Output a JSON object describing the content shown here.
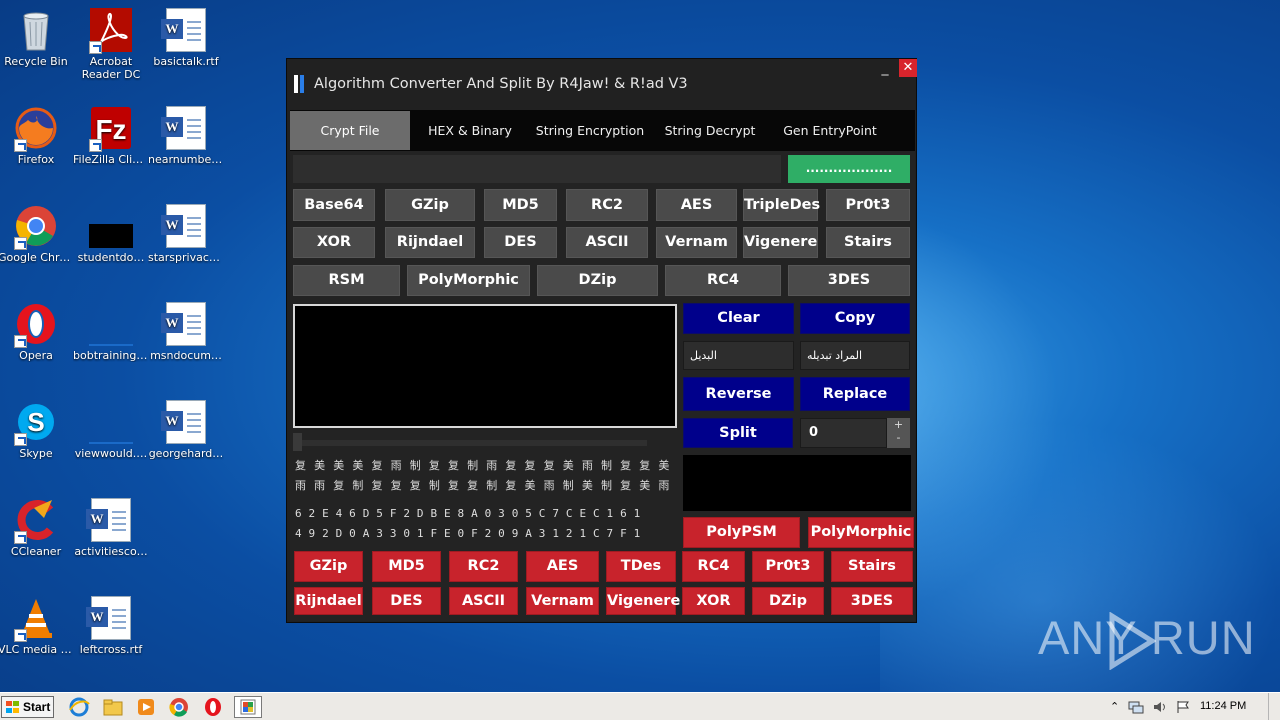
{
  "desktop": {
    "icons": [
      {
        "label": "Recycle Bin",
        "icon": "recycle-bin-icon"
      },
      {
        "label": "Acrobat Reader DC",
        "icon": "acrobat-icon"
      },
      {
        "label": "basictalk.rtf",
        "icon": "word-doc-icon"
      },
      {
        "label": "Firefox",
        "icon": "firefox-icon"
      },
      {
        "label": "FileZilla Client",
        "icon": "filezilla-icon"
      },
      {
        "label": "nearnumber…",
        "icon": "word-doc-icon"
      },
      {
        "label": "Google Chrome",
        "icon": "chrome-icon"
      },
      {
        "label": "studentdo…",
        "icon": "black-file-icon"
      },
      {
        "label": "starsprivacy…",
        "icon": "word-doc-icon"
      },
      {
        "label": "Opera",
        "icon": "opera-icon"
      },
      {
        "label": "bobtraining.…",
        "icon": "blank-file-icon"
      },
      {
        "label": "msndocum…",
        "icon": "word-doc-icon"
      },
      {
        "label": "Skype",
        "icon": "skype-icon"
      },
      {
        "label": "viewwould.…",
        "icon": "blank-file-icon"
      },
      {
        "label": "georgehard…",
        "icon": "word-doc-icon"
      },
      {
        "label": "CCleaner",
        "icon": "ccleaner-icon"
      },
      {
        "label": "activitiesco…",
        "icon": "word-doc-icon"
      },
      {
        "label": "VLC media player",
        "icon": "vlc-icon"
      },
      {
        "label": "leftcross.rtf",
        "icon": "word-doc-icon"
      }
    ]
  },
  "window": {
    "title": "Algorithm Converter And Split By R4Jaw! & R!ad V3",
    "minimize": "_",
    "close": "✕",
    "tabs": [
      "Crypt File",
      "HEX & Binary",
      "String Encryption",
      "String Decrypt",
      "Gen EntryPoint"
    ],
    "active_tab": "Crypt File",
    "browse_label": "...................",
    "algo_row1": [
      "Base64",
      "GZip",
      "MD5",
      "RC2",
      "AES",
      "TripleDes",
      "Pr0t3"
    ],
    "algo_row2": [
      "XOR",
      "Rijndael",
      "DES",
      "ASCII",
      "Vernam",
      "Vigenere",
      "Stairs"
    ],
    "algo_row3": [
      "RSM",
      "PolyMorphic",
      "DZip",
      "RC4",
      "3DES"
    ],
    "clear": "Clear",
    "copy": "Copy",
    "replace_from": "البديل",
    "replace_to": "المراد تبديله",
    "reverse": "Reverse",
    "replace": "Replace",
    "split": "Split",
    "split_value": "0",
    "spin_up": "+",
    "spin_down": "-",
    "glyph_line1": "复 美 美 美 复 雨 制 复 复 制 雨 复 复 复 美 雨 制 复 复 美",
    "glyph_line2": "雨 雨 复 制 复 复 复 制 复 复 制 复 美 雨 制 美 制 复 美 雨",
    "hex_line1": "6 2 E 4 6 D 5 F 2 D B E 8 A 0 3 0 5 C 7 C E C 1 6 1",
    "hex_line2": "4 9 2 D 0 A 3 3 0 1 F E 0 F 2 0 9 A 3 1 2 1 C 7 F 1",
    "poly_buttons": [
      "PolyPSM",
      "PolyMorphic"
    ],
    "red_row1": [
      "GZip",
      "MD5",
      "RC2",
      "AES",
      "TDes",
      "RC4",
      "Pr0t3",
      "Stairs"
    ],
    "red_row2": [
      "Rijndael",
      "DES",
      "ASCII",
      "Vernam",
      "Vigenere",
      "XOR",
      "DZip",
      "3DES"
    ]
  },
  "taskbar": {
    "start": "Start",
    "clock": "11:24 PM"
  },
  "watermark": "ANY  RUN",
  "colors": {
    "panel_bg": "#232323",
    "grey_button": "#4a4a4a",
    "navy_button": "#00008b",
    "red_button": "#c8232c",
    "green_button": "#2fae66",
    "close_red": "#d8242c"
  }
}
